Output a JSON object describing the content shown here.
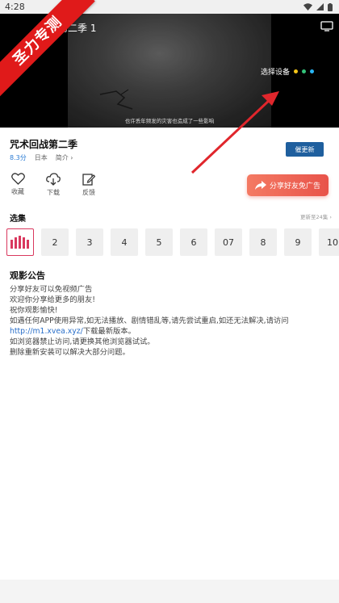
{
  "status_bar": {
    "time": "4:28"
  },
  "player": {
    "title": "战第二季 1",
    "device_select_label": "选择设备",
    "device_dots": [
      "#f5c518",
      "#33c47a",
      "#29b6f6"
    ],
    "subtitle": "也许丢年频发的灾害也造成了一些影响"
  },
  "ribbon": {
    "text": "圣力专测"
  },
  "show": {
    "title": "咒术回战第二季",
    "score": "8.3分",
    "region": "日本",
    "intro": "简介 ›",
    "urge_button": "催更新"
  },
  "actions": [
    {
      "label": "收藏",
      "icon": "heart-icon"
    },
    {
      "label": "下载",
      "icon": "download-icon"
    },
    {
      "label": "反馈",
      "icon": "feedback-icon"
    }
  ],
  "share_button": {
    "label": "分享好友免广告"
  },
  "episodes": {
    "heading": "选集",
    "update_text": "更新至24集 ›",
    "items": [
      "",
      "2",
      "3",
      "4",
      "5",
      "6",
      "07",
      "8",
      "9",
      "10"
    ]
  },
  "notice": {
    "heading": "观影公告",
    "line1": "分享好友可以免视频广告",
    "line2": "欢迎你分享给更多的朋友!",
    "line3": "祝你观影愉快!",
    "line4": "如遇任何APP使用异常,如无法播放、剧情错乱等,请先尝试重启,如还无法解决,请访问",
    "link": "http://m1.xvea.xyz/",
    "link_suffix": "下载最新版本。",
    "line6": "如浏览器禁止访问,请更换其他浏览器试试。",
    "line7": "删除重新安装可以解决大部分问题。"
  },
  "colors": {
    "accent": "#1f5f9e",
    "ribbon": "#e01a1a",
    "share": "#e8534a",
    "link": "#2a6fc9"
  }
}
